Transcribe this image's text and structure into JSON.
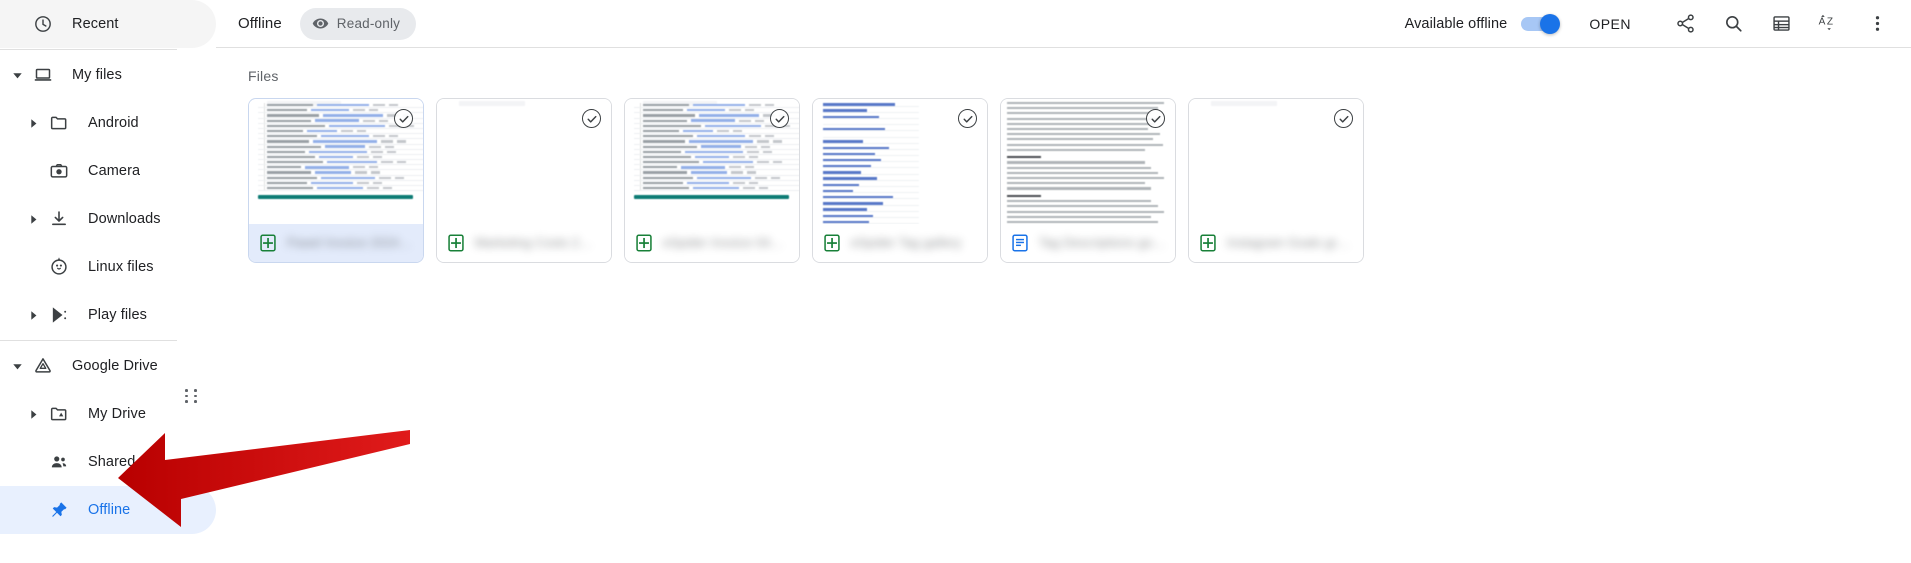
{
  "app": {
    "title": "Files"
  },
  "sidebar": {
    "items": [
      {
        "label": "Recent",
        "icon": "clock-icon",
        "level": 0,
        "twisty": "none",
        "selected": false
      },
      {
        "label": "My files",
        "icon": "laptop-icon",
        "level": 0,
        "twisty": "expanded",
        "selected": false
      },
      {
        "label": "Android",
        "icon": "folder-icon",
        "level": 1,
        "twisty": "collapsed",
        "selected": false
      },
      {
        "label": "Camera",
        "icon": "camera-icon",
        "level": 1,
        "twisty": "none",
        "selected": false
      },
      {
        "label": "Downloads",
        "icon": "download-icon",
        "level": 1,
        "twisty": "collapsed",
        "selected": false
      },
      {
        "label": "Linux files",
        "icon": "linux-penguin-icon",
        "level": 1,
        "twisty": "none",
        "selected": false
      },
      {
        "label": "Play files",
        "icon": "play-store-icon",
        "level": 1,
        "twisty": "collapsed",
        "selected": false
      },
      {
        "label": "Google Drive",
        "icon": "google-drive-icon",
        "level": 0,
        "twisty": "expanded",
        "selected": false
      },
      {
        "label": "My Drive",
        "icon": "drive-folder-icon",
        "level": 1,
        "twisty": "collapsed",
        "selected": false
      },
      {
        "label": "Shared wit…",
        "icon": "people-icon",
        "level": 1,
        "twisty": "none",
        "selected": false
      },
      {
        "label": "Offline",
        "icon": "pin-icon",
        "level": 1,
        "twisty": "none",
        "selected": true
      }
    ],
    "separator_after": [
      0,
      6
    ]
  },
  "toolbar": {
    "title": "Offline",
    "readonly_chip": {
      "label": "Read-only",
      "icon": "eye-icon"
    },
    "available_offline_label": "Available offline",
    "toggle": {
      "name": "available-offline-toggle",
      "state": "on",
      "accent": "#1a73e8"
    },
    "open_label": "OPEN",
    "icons": [
      {
        "name": "share-icon",
        "title": "Share"
      },
      {
        "name": "search-icon",
        "title": "Search"
      },
      {
        "name": "list-view-icon",
        "title": "Switch to list view"
      },
      {
        "name": "sort-az-icon",
        "title": "Sort A-Z"
      },
      {
        "name": "more-vert-icon",
        "title": "More options"
      }
    ]
  },
  "content": {
    "section_heading": "Files",
    "cards": [
      {
        "name": "Pawel Invoice 2024…",
        "filetype": "sheets",
        "preview": "sheet",
        "selected": true,
        "offline_badge": true
      },
      {
        "name": "Marketing Costs 2…",
        "filetype": "sheets",
        "preview": "blank",
        "selected": false,
        "offline_badge": true
      },
      {
        "name": "eSpider Invoice 04…",
        "filetype": "sheets",
        "preview": "sheet",
        "selected": false,
        "offline_badge": true
      },
      {
        "name": "eSpider Tag gallery",
        "filetype": "sheets",
        "preview": "links",
        "selected": false,
        "offline_badge": true
      },
      {
        "name": "Tag Descriptions go…",
        "filetype": "docs",
        "preview": "text",
        "selected": false,
        "offline_badge": true
      },
      {
        "name": "Instagram Goals gr…",
        "filetype": "sheets",
        "preview": "blank",
        "selected": false,
        "offline_badge": true
      }
    ]
  },
  "annotation": {
    "type": "red-arrow",
    "points_to": "Offline",
    "color": "#cc0000"
  },
  "colors": {
    "accent_blue": "#1a73e8",
    "selected_row_bg": "#e8f0fe",
    "selected_card_bg": "#e3ebfb",
    "chip_bg": "#e8eaed",
    "sheets_green": "#188038",
    "docs_blue": "#1a73e8",
    "border": "#dadce0",
    "text_primary": "#202124",
    "text_secondary": "#5f6368"
  }
}
